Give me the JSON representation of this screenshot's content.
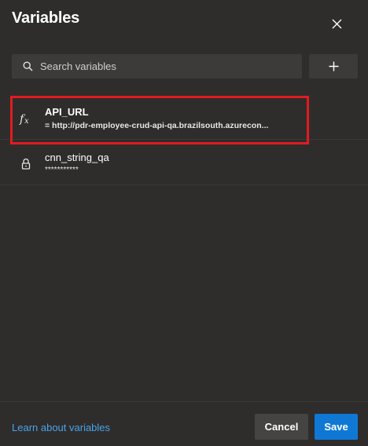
{
  "dialog": {
    "title": "Variables",
    "close_icon": "close-icon"
  },
  "search": {
    "placeholder": "Search variables",
    "value": "",
    "icon": "search-icon"
  },
  "add_button": {
    "icon": "plus-icon"
  },
  "variables": [
    {
      "name": "API_URL",
      "value": "= http://pdr-employee-crud-api-qa.brazilsouth.azurecon...",
      "icon": "function-icon",
      "highlighted": true
    },
    {
      "name": "cnn_string_qa",
      "value": "***********",
      "icon": "lock-icon",
      "highlighted": false
    }
  ],
  "footer": {
    "learn_link": "Learn about variables",
    "cancel_label": "Cancel",
    "save_label": "Save"
  },
  "colors": {
    "background": "#2e2d2c",
    "accent": "#0f78d4",
    "link": "#4aa3e8",
    "highlight_border": "#e11b22"
  }
}
